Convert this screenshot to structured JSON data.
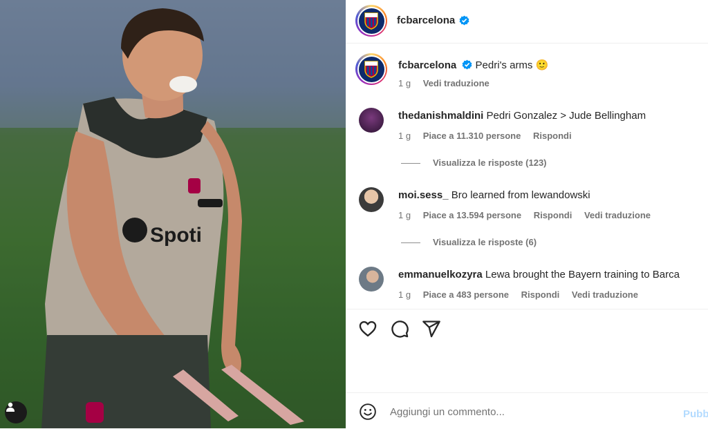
{
  "post": {
    "author": "fcbarcelona",
    "caption": "Pedri's arms 🙂",
    "age": "1 g",
    "translate_label": "Vedi traduzione"
  },
  "comments": [
    {
      "username": "thedanishmaldini",
      "text": "Pedri Gonzalez > Jude Bellingham",
      "age": "1 g",
      "likes": "Piace a 11.310 persone",
      "reply_label": "Rispondi",
      "view_replies": "Visualizza le risposte (123)"
    },
    {
      "username": "moi.sess_",
      "text": "Bro learned from lewandowski",
      "age": "1 g",
      "likes": "Piace a 13.594 persone",
      "reply_label": "Rispondi",
      "translate_label": "Vedi traduzione",
      "view_replies": "Visualizza le risposte (6)"
    },
    {
      "username": "emmanuelkozyra",
      "text": "Lewa brought the Bayern training to Barca",
      "age": "1 g",
      "likes": "Piace a 483 persone",
      "reply_label": "Rispondi",
      "translate_label": "Vedi traduzione"
    }
  ],
  "composer": {
    "placeholder": "Aggiungi un commento...",
    "publish_label": "Pubb"
  },
  "photo": {
    "sponsor_text": "Spoti"
  },
  "colors": {
    "verified": "#0095f6",
    "publish_disabled": "#b3dbff",
    "meta_gray": "#737373"
  },
  "icons": [
    "verified-badge-icon",
    "heart-icon",
    "comment-icon",
    "share-icon",
    "emoji-icon",
    "user-tag-icon"
  ]
}
